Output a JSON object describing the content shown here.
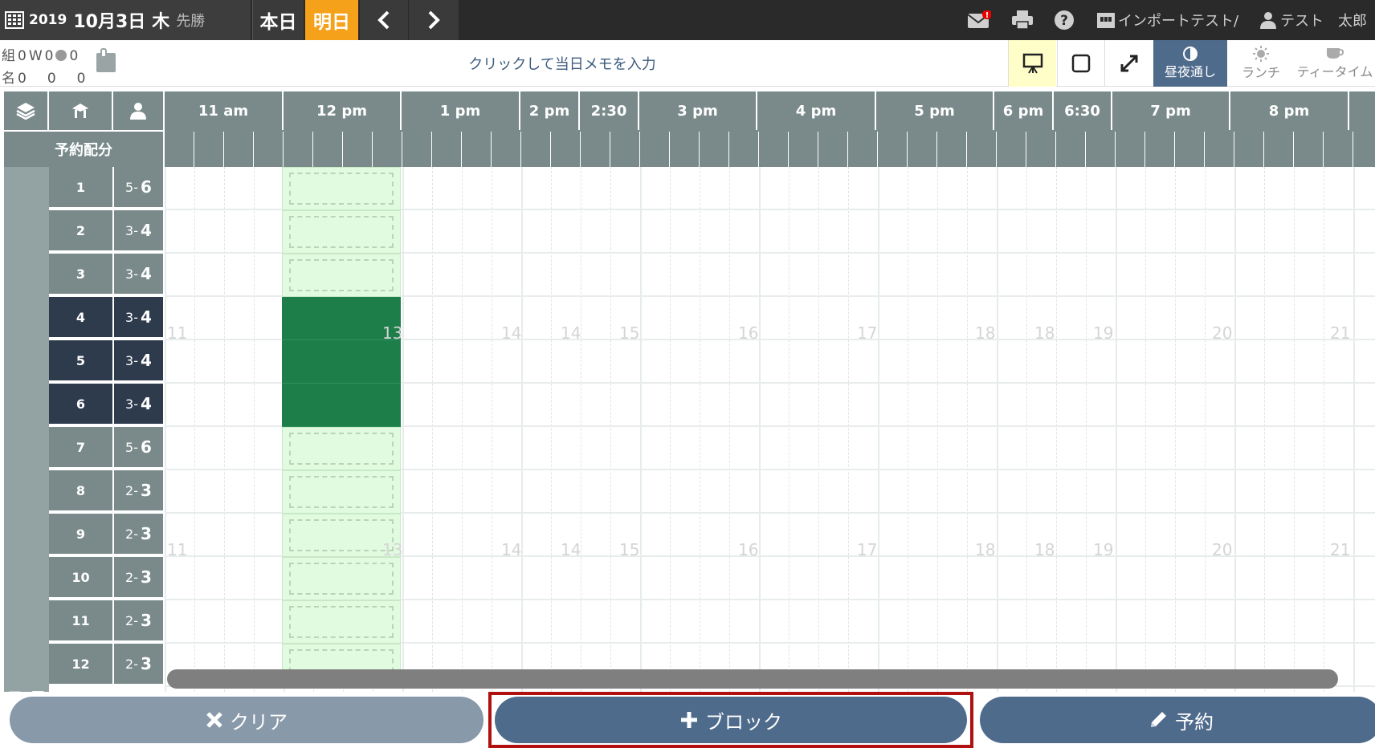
{
  "topbar": {
    "year": "2019",
    "month_day": "10月3日",
    "weekday": "木",
    "rokuyo": "先勝",
    "today_label": "本日",
    "tomorrow_label": "明日",
    "import_label": "インポートテスト/",
    "user_label": "テスト　太郎",
    "accent_color": "#f5a11a"
  },
  "bar2": {
    "stats_row1": [
      "組",
      "0",
      "W",
      "0",
      "0"
    ],
    "stats_row2": [
      "名",
      "0",
      "0",
      "0"
    ],
    "memo_placeholder": "クリックして当日メモを入力",
    "allday_label": "昼夜通し",
    "lunch_label": "ランチ",
    "tea_label": "ティータイム"
  },
  "grid": {
    "sub_label": "予約配分",
    "floor_label": "フロア",
    "time_headers": [
      "11 am",
      "12 pm",
      "1 pm",
      "2 pm",
      "2:30",
      "3 pm",
      "4 pm",
      "5 pm",
      "6 pm",
      "6:30",
      "7 pm",
      "8 pm"
    ],
    "rows": [
      {
        "num": "1",
        "cap_min": "5",
        "cap_max": "6",
        "selected": false
      },
      {
        "num": "2",
        "cap_min": "3",
        "cap_max": "4",
        "selected": false
      },
      {
        "num": "3",
        "cap_min": "3",
        "cap_max": "4",
        "selected": false
      },
      {
        "num": "4",
        "cap_min": "3",
        "cap_max": "4",
        "selected": true
      },
      {
        "num": "5",
        "cap_min": "3",
        "cap_max": "4",
        "selected": true
      },
      {
        "num": "6",
        "cap_min": "3",
        "cap_max": "4",
        "selected": true
      },
      {
        "num": "7",
        "cap_min": "5",
        "cap_max": "6",
        "selected": false
      },
      {
        "num": "8",
        "cap_min": "2",
        "cap_max": "3",
        "selected": false
      },
      {
        "num": "9",
        "cap_min": "2",
        "cap_max": "3",
        "selected": false
      },
      {
        "num": "10",
        "cap_min": "2",
        "cap_max": "3",
        "selected": false
      },
      {
        "num": "11",
        "cap_min": "2",
        "cap_max": "3",
        "selected": false
      },
      {
        "num": "12",
        "cap_min": "2",
        "cap_max": "3",
        "selected": false
      }
    ],
    "watermarks": [
      "11",
      "13",
      "14",
      "14",
      "15",
      "16",
      "17",
      "18",
      "18",
      "19",
      "20",
      "21"
    ]
  },
  "bottom": {
    "clear_label": "クリア",
    "block_label": "ブロック",
    "reserve_label": "予約"
  }
}
